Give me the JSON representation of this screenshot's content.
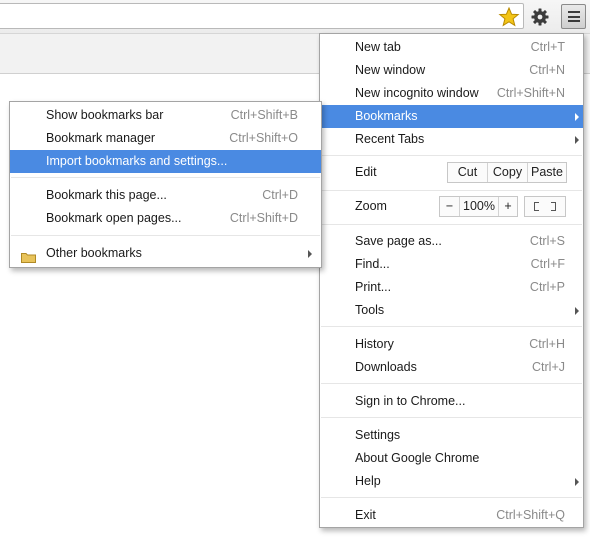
{
  "toolbar": {
    "star_icon": "bookmark-star-icon",
    "gear_icon": "gear-icon",
    "menu_icon": "hamburger-menu-icon",
    "star_color": "#f2c417"
  },
  "main_menu": {
    "new_tab": {
      "label": "New tab",
      "shortcut": "Ctrl+T"
    },
    "new_window": {
      "label": "New window",
      "shortcut": "Ctrl+N"
    },
    "new_incognito": {
      "label": "New incognito window",
      "shortcut": "Ctrl+Shift+N"
    },
    "bookmarks": {
      "label": "Bookmarks"
    },
    "recent_tabs": {
      "label": "Recent Tabs"
    },
    "edit": {
      "label": "Edit",
      "cut": "Cut",
      "copy": "Copy",
      "paste": "Paste"
    },
    "zoom": {
      "label": "Zoom",
      "minus": "−",
      "level": "100%",
      "plus": "+"
    },
    "save_page": {
      "label": "Save page as...",
      "shortcut": "Ctrl+S"
    },
    "find": {
      "label": "Find...",
      "shortcut": "Ctrl+F"
    },
    "print": {
      "label": "Print...",
      "shortcut": "Ctrl+P"
    },
    "tools": {
      "label": "Tools"
    },
    "history": {
      "label": "History",
      "shortcut": "Ctrl+H"
    },
    "downloads": {
      "label": "Downloads",
      "shortcut": "Ctrl+J"
    },
    "sign_in": {
      "label": "Sign in to Chrome..."
    },
    "settings": {
      "label": "Settings"
    },
    "about": {
      "label": "About Google Chrome"
    },
    "help": {
      "label": "Help"
    },
    "exit": {
      "label": "Exit",
      "shortcut": "Ctrl+Shift+Q"
    }
  },
  "bookmarks_menu": {
    "show_bar": {
      "label": "Show bookmarks bar",
      "shortcut": "Ctrl+Shift+B"
    },
    "manager": {
      "label": "Bookmark manager",
      "shortcut": "Ctrl+Shift+O"
    },
    "import": {
      "label": "Import bookmarks and settings..."
    },
    "bookmark_page": {
      "label": "Bookmark this page...",
      "shortcut": "Ctrl+D"
    },
    "bookmark_open": {
      "label": "Bookmark open pages...",
      "shortcut": "Ctrl+Shift+D"
    },
    "other": {
      "label": "Other bookmarks",
      "icon": "folder-icon"
    }
  },
  "colors": {
    "highlight": "#4a8ae2",
    "shortcut_text": "#8a8a8a",
    "folder": "#e8c35a"
  }
}
